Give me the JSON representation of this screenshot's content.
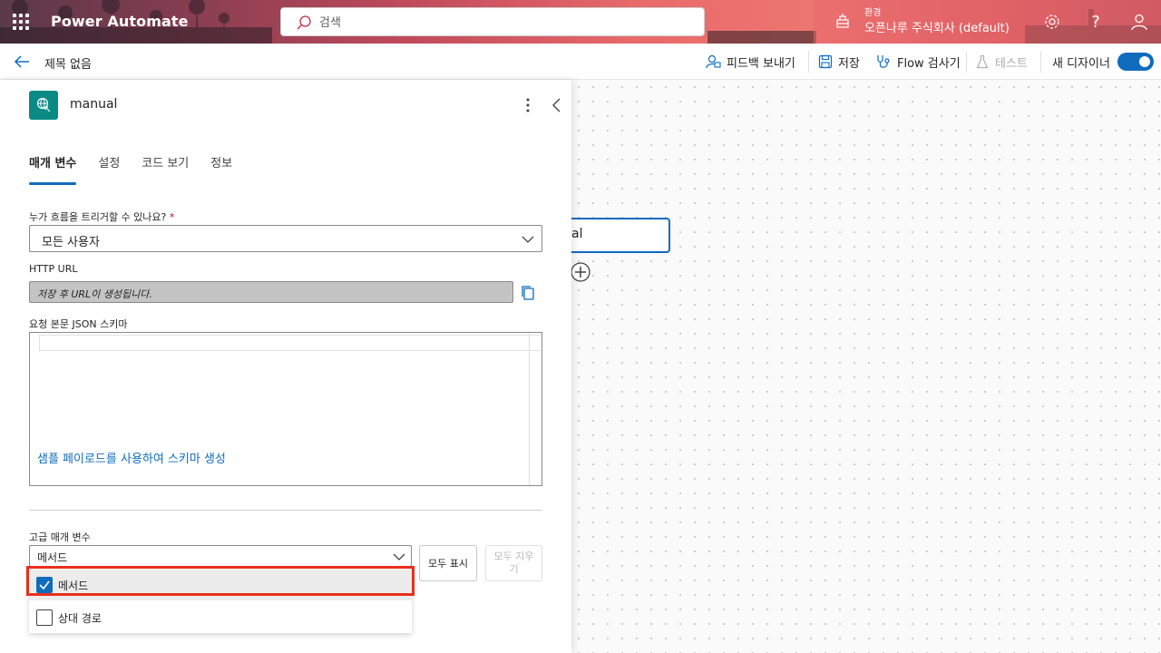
{
  "header": {
    "app_title": "Power Automate",
    "search_placeholder": "검색",
    "environment_label": "환경",
    "environment_value": "오픈나루 주식회사 (default)"
  },
  "command_bar": {
    "flow_title": "제목 없음",
    "feedback": "피드백 보내기",
    "save": "저장",
    "flow_checker": "Flow 검사기",
    "test": "테스트",
    "new_designer": "새 디자이너",
    "new_designer_on": true
  },
  "canvas": {
    "node_label": "al"
  },
  "panel": {
    "title": "manual",
    "tabs": [
      {
        "label": "매개 변수",
        "active": true
      },
      {
        "label": "설정",
        "active": false
      },
      {
        "label": "코드 보기",
        "active": false
      },
      {
        "label": "정보",
        "active": false
      }
    ],
    "who_can_trigger_label": "누가 흐름을 트리거할 수 있나요?",
    "who_can_trigger_required": "*",
    "who_can_trigger_value": "모든 사용자",
    "http_url_label": "HTTP URL",
    "http_url_value": "저장 후 URL이 생성됩니다.",
    "schema_label": "요청 본문 JSON 스키마",
    "schema_link": "샘플 페이로드를 사용하여 스키마 생성",
    "advanced_label": "고급 매개 변수",
    "advanced_value": "메서드",
    "show_all": "모두 표시",
    "clear_all": "모두 지우기",
    "options": [
      {
        "label": "메서드",
        "checked": true
      },
      {
        "label": "상대 경로",
        "checked": false
      }
    ]
  },
  "colors": {
    "accent": "#0f6cbd",
    "highlight": "#e8301c",
    "panel_icon": "#0a8a84"
  }
}
